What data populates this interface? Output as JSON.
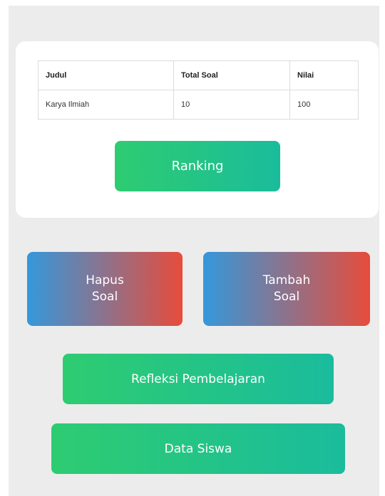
{
  "table": {
    "headers": [
      "Judul",
      "Total Soal",
      "Nilai"
    ],
    "rows": [
      [
        "Karya Ilmiah",
        "10",
        "100"
      ]
    ]
  },
  "buttons": {
    "ranking": "Ranking",
    "hapus_soal": {
      "line1": "Hapus",
      "line2": "Soal"
    },
    "tambah_soal": {
      "line1": "Tambah",
      "line2": "Soal"
    },
    "refleksi": "Refleksi Pembelajaran",
    "data_siswa": "Data Siswa"
  },
  "colors": {
    "green_start": "#2ecc71",
    "green_end": "#1abc9c",
    "blue": "#3498db",
    "red": "#e74c3c",
    "background": "#ececec"
  }
}
